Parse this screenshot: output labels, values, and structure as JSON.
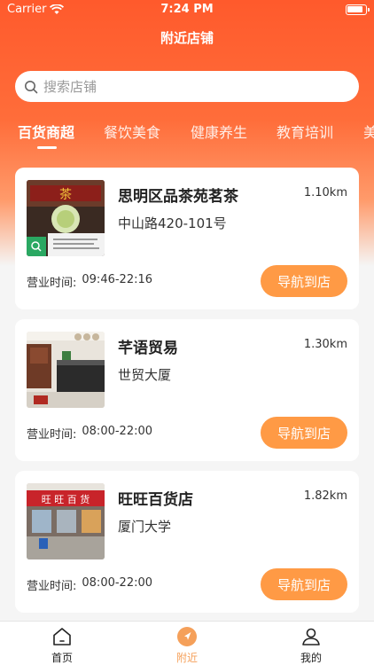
{
  "status_bar": {
    "carrier": "Carrier",
    "time": "7:24 PM"
  },
  "header": {
    "title": "附近店铺"
  },
  "search": {
    "placeholder": "搜索店铺"
  },
  "tabs": [
    {
      "label": "百货商超",
      "active": true
    },
    {
      "label": "餐饮美食",
      "active": false
    },
    {
      "label": "健康养生",
      "active": false
    },
    {
      "label": "教育培训",
      "active": false
    },
    {
      "label": "美",
      "active": false
    }
  ],
  "stores": [
    {
      "name": "思明区品茶苑茗茶",
      "distance": "1.10km",
      "address": "中山路420-101号",
      "hours_label": "营业时间:",
      "hours": "09:46-22:16",
      "nav_label": "导航到店"
    },
    {
      "name": "芊语贸易",
      "distance": "1.30km",
      "address": "世贸大厦",
      "hours_label": "营业时间:",
      "hours": "08:00-22:00",
      "nav_label": "导航到店"
    },
    {
      "name": "旺旺百货店",
      "distance": "1.82km",
      "address": "厦门大学",
      "hours_label": "营业时间:",
      "hours": "08:00-22:00",
      "nav_label": "导航到店"
    }
  ],
  "tabbar": [
    {
      "label": "首页",
      "icon": "home-icon",
      "active": false
    },
    {
      "label": "附近",
      "icon": "location-arrow-icon",
      "active": true
    },
    {
      "label": "我的",
      "icon": "person-icon",
      "active": false
    }
  ],
  "colors": {
    "primary": "#ff5a2c",
    "button": "#ff9a45",
    "active_tab_label": "#f5a05a"
  },
  "thumbnails": {
    "store1_sign_text": "茶",
    "store3_sign_text": "旺 旺 百 货"
  }
}
